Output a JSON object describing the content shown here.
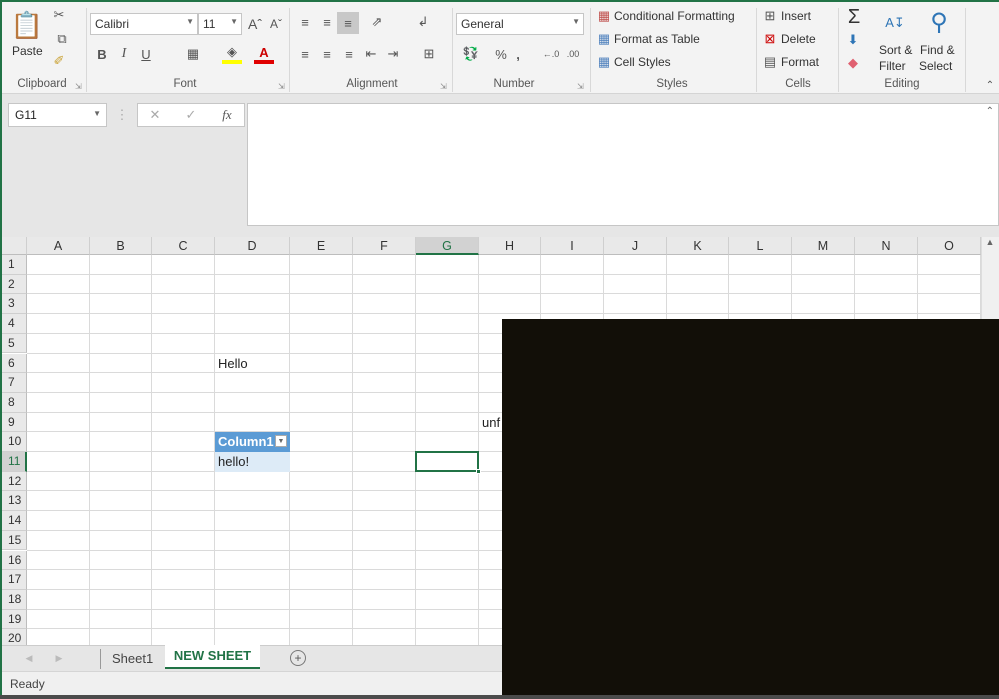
{
  "ribbon": {
    "clipboard": {
      "label": "Clipboard",
      "paste": "Paste"
    },
    "font": {
      "label": "Font",
      "name": "Calibri",
      "size": "11",
      "bold": "B",
      "italic": "I",
      "underline": "U"
    },
    "alignment": {
      "label": "Alignment"
    },
    "number": {
      "label": "Number",
      "format": "General",
      "percent": "%",
      "comma": ","
    },
    "styles": {
      "label": "Styles",
      "conditional": "Conditional Formatting",
      "format_table": "Format as Table",
      "cell_styles": "Cell Styles"
    },
    "cells": {
      "label": "Cells",
      "insert": "Insert",
      "delete": "Delete",
      "format": "Format"
    },
    "editing": {
      "label": "Editing",
      "sort_1": "Sort &",
      "sort_2": "Filter",
      "find_1": "Find &",
      "find_2": "Select"
    }
  },
  "formula_bar": {
    "name_box": "G11",
    "formula": "",
    "fx": "fx"
  },
  "grid": {
    "columns": [
      "A",
      "B",
      "C",
      "D",
      "E",
      "F",
      "G",
      "H",
      "I",
      "J",
      "K",
      "L",
      "M",
      "N",
      "O"
    ],
    "rows": [
      "1",
      "2",
      "3",
      "4",
      "5",
      "6",
      "7",
      "8",
      "9",
      "10",
      "11",
      "12",
      "13",
      "14",
      "15",
      "16",
      "17",
      "18",
      "19",
      "20"
    ],
    "selected_cell": "G11",
    "cells": {
      "D6": "Hello",
      "H9": "unf",
      "D10": "Column1",
      "D11": "hello!"
    }
  },
  "sheets": {
    "tabs": [
      "Sheet1",
      "NEW SHEET"
    ],
    "active": "NEW SHEET"
  },
  "status": {
    "text": "Ready"
  },
  "colors": {
    "accent": "#217346",
    "table_header": "#5b9bd5",
    "table_row": "#ddebf7"
  }
}
